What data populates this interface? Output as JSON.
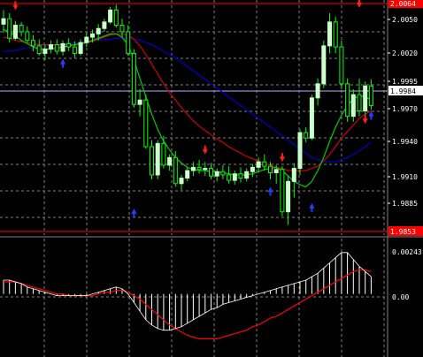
{
  "price_axis": {
    "labels": [
      "2.0050",
      "2.0020",
      "1.9995",
      "1.9970",
      "1.9940",
      "1.9910",
      "1.9885"
    ],
    "current_price": "1.9984",
    "high_line": "2.0064",
    "low_line": "1.9853"
  },
  "indicator_axis": {
    "labels": [
      "0.00243",
      "0.00"
    ]
  },
  "colors": {
    "background": "#000000",
    "grid": "#808080",
    "bull_candle": "#ccffcc",
    "wick": "#00ff00",
    "ma_fast": "#00cc00",
    "ma_mid": "#cc0000",
    "ma_slow": "#0000cc",
    "signal_line": "#ff0000",
    "hline": "#ff0000",
    "current_line": "#b0b0ff",
    "arrow_down": "#ff2020",
    "arrow_up": "#2040ff",
    "histogram": "#ffffff"
  },
  "chart_data": [
    {
      "type": "candlestick",
      "ylim": [
        1.9853,
        2.0064
      ],
      "grid": true,
      "candles": [
        [
          2.0045,
          2.0058,
          2.0037,
          2.005
        ],
        [
          2.005,
          2.0055,
          2.0028,
          2.0032
        ],
        [
          2.0032,
          2.0048,
          2.003,
          2.0044
        ],
        [
          2.0044,
          2.0047,
          2.0034,
          2.0038
        ],
        [
          2.0038,
          2.0043,
          2.0028,
          2.003
        ],
        [
          2.003,
          2.0035,
          2.002,
          2.0025
        ],
        [
          2.0025,
          2.0031,
          2.0016,
          2.0018
        ],
        [
          2.0018,
          2.0026,
          2.0012,
          2.0022
        ],
        [
          2.0022,
          2.003,
          2.0018,
          2.0026
        ],
        [
          2.0026,
          2.0031,
          2.0017,
          2.002
        ],
        [
          2.002,
          2.003,
          2.0016,
          2.0027
        ],
        [
          2.0027,
          2.0032,
          2.002,
          2.0024
        ],
        [
          2.0024,
          2.0029,
          2.0014,
          2.0018
        ],
        [
          2.0018,
          2.0031,
          2.0016,
          2.0028
        ],
        [
          2.0028,
          2.0037,
          2.0024,
          2.0033
        ],
        [
          2.0033,
          2.004,
          2.0028,
          2.0036
        ],
        [
          2.0036,
          2.0045,
          2.003,
          2.0041
        ],
        [
          2.0041,
          2.005,
          2.0038,
          2.0047
        ],
        [
          2.0047,
          2.0061,
          2.0045,
          2.0058
        ],
        [
          2.0058,
          2.0063,
          2.0042,
          2.0044
        ],
        [
          2.0044,
          2.005,
          2.0033,
          2.0038
        ],
        [
          2.0038,
          2.0044,
          2.0016,
          2.0018
        ],
        [
          2.0018,
          2.0022,
          1.9968,
          1.9971
        ],
        [
          1.9971,
          1.9985,
          1.996,
          1.9975
        ],
        [
          1.9975,
          1.998,
          1.993,
          1.9932
        ],
        [
          1.9932,
          1.9938,
          1.9902,
          1.9906
        ],
        [
          1.9906,
          1.9938,
          1.9902,
          1.9935
        ],
        [
          1.9935,
          1.9942,
          1.9912,
          1.9915
        ],
        [
          1.9915,
          1.9925,
          1.991,
          1.9922
        ],
        [
          1.9922,
          1.9928,
          1.9895,
          1.9898
        ],
        [
          1.9898,
          1.9906,
          1.9892,
          1.9903
        ],
        [
          1.9903,
          1.9913,
          1.99,
          1.991
        ],
        [
          1.991,
          1.9918,
          1.9905,
          1.9913
        ],
        [
          1.9913,
          1.992,
          1.9907,
          1.9911
        ],
        [
          1.9911,
          1.9918,
          1.9905,
          1.9912
        ],
        [
          1.9912,
          1.9917,
          1.9902,
          1.9905
        ],
        [
          1.9905,
          1.9912,
          1.99,
          1.9909
        ],
        [
          1.9909,
          1.9915,
          1.9902,
          1.9906
        ],
        [
          1.9906,
          1.9914,
          1.9898,
          1.9901
        ],
        [
          1.9901,
          1.991,
          1.9897,
          1.9907
        ],
        [
          1.9907,
          1.9913,
          1.9899,
          1.9903
        ],
        [
          1.9903,
          1.9912,
          1.99,
          1.9909
        ],
        [
          1.9909,
          1.9916,
          1.9904,
          1.9913
        ],
        [
          1.9913,
          1.9922,
          1.9908,
          1.9918
        ],
        [
          1.9918,
          1.9925,
          1.991,
          1.9914
        ],
        [
          1.9914,
          1.9918,
          1.9902,
          1.9908
        ],
        [
          1.9908,
          1.9915,
          1.9898,
          1.9911
        ],
        [
          1.9911,
          1.9914,
          1.9868,
          1.9872
        ],
        [
          1.9872,
          1.9905,
          1.986,
          1.99
        ],
        [
          1.99,
          1.9917,
          1.9885,
          1.9912
        ],
        [
          1.9912,
          1.9948,
          1.9906,
          1.9945
        ],
        [
          1.9945,
          1.995,
          1.9936,
          1.994
        ],
        [
          1.994,
          1.998,
          1.9938,
          1.9977
        ],
        [
          1.9977,
          1.9995,
          1.997,
          1.999
        ],
        [
          1.999,
          2.003,
          1.9986,
          2.0025
        ],
        [
          2.0025,
          2.0055,
          2.0018,
          2.0047
        ],
        [
          2.0047,
          2.0052,
          2.0018,
          2.0024
        ],
        [
          2.0024,
          2.003,
          1.9985,
          1.999
        ],
        [
          1.999,
          1.9995,
          1.9955,
          1.996
        ],
        [
          1.996,
          1.9985,
          1.9955,
          1.998
        ],
        [
          1.998,
          1.9995,
          1.996,
          1.9965
        ],
        [
          1.9965,
          1.9992,
          1.9958,
          1.9988
        ],
        [
          1.9988,
          1.9994,
          1.9966,
          1.997
        ]
      ],
      "ma_fast": [
        2.004,
        2.0038,
        2.0034,
        2.003,
        2.0027,
        2.0024,
        2.0022,
        2.0022,
        2.0022,
        2.0023,
        2.0024,
        2.0025,
        2.0026,
        2.0027,
        2.0028,
        2.003,
        2.0032,
        2.0034,
        2.0036,
        2.0036,
        2.0033,
        2.0026,
        2.0012,
        1.9995,
        1.9978,
        1.9962,
        1.9948,
        1.9937,
        1.9929,
        1.9922,
        1.9917,
        1.9913,
        1.9911,
        1.991,
        1.991,
        1.9909,
        1.9909,
        1.9908,
        1.9907,
        1.9906,
        1.9906,
        1.9906,
        1.9907,
        1.9909,
        1.9911,
        1.9912,
        1.9913,
        1.991,
        1.9905,
        1.99,
        1.9897,
        1.9895,
        1.99,
        1.991,
        1.9922,
        1.9937,
        1.995,
        1.9961,
        1.997,
        1.9976,
        1.9979,
        1.9978,
        1.9975
      ],
      "ma_mid": [
        2.0033,
        2.0032,
        2.003,
        2.0029,
        2.0028,
        2.0027,
        2.0026,
        2.0026,
        2.0026,
        2.0026,
        2.0026,
        2.0026,
        2.0026,
        2.0027,
        2.0028,
        2.0029,
        2.0031,
        2.0033,
        2.0035,
        2.0036,
        2.0036,
        2.0035,
        2.0031,
        2.0025,
        2.0017,
        2.0008,
        1.9999,
        1.999,
        1.9982,
        1.9975,
        1.9968,
        1.9962,
        1.9956,
        1.9951,
        1.9947,
        1.9943,
        1.9939,
        1.9936,
        1.9932,
        1.9929,
        1.9926,
        1.9923,
        1.9921,
        1.9919,
        1.9917,
        1.9915,
        1.9913,
        1.9912,
        1.991,
        1.991,
        1.991,
        1.991,
        1.9912,
        1.9914,
        1.9919,
        1.9925,
        1.9932,
        1.994,
        1.9946,
        1.9952,
        1.9958,
        1.9962,
        1.9965
      ],
      "ma_slow": [
        2.002,
        2.002,
        2.0021,
        2.0022,
        2.0023,
        2.0024,
        2.0025,
        2.0025,
        2.0026,
        2.0026,
        2.0027,
        2.0027,
        2.0028,
        2.0028,
        2.0029,
        2.003,
        2.003,
        2.0031,
        2.0031,
        2.0032,
        2.0032,
        2.0032,
        2.0031,
        2.003,
        2.0028,
        2.0026,
        2.0023,
        2.002,
        2.0017,
        2.0014,
        2.001,
        2.0006,
        2.0002,
        1.9998,
        1.9994,
        1.999,
        1.9986,
        1.9982,
        1.9978,
        1.9974,
        1.997,
        1.9966,
        1.9962,
        1.9958,
        1.9954,
        1.995,
        1.9946,
        1.9942,
        1.9938,
        1.9934,
        1.993,
        1.9926,
        1.9922,
        1.992,
        1.9918,
        1.9918,
        1.9918,
        1.992,
        1.9922,
        1.9925,
        1.9928,
        1.9932,
        1.9936
      ],
      "arrows_down": [
        [
          2,
          2.0058
        ],
        [
          18,
          2.0068
        ],
        [
          34,
          1.9925
        ],
        [
          47,
          1.9918
        ],
        [
          60,
          2.006
        ],
        [
          61,
          1.9953
        ]
      ],
      "arrows_up": [
        [
          10,
          2.0013
        ],
        [
          22,
          1.9875
        ],
        [
          45,
          1.9895
        ],
        [
          52,
          1.988
        ],
        [
          62,
          1.9965
        ]
      ]
    },
    {
      "type": "histogram+line",
      "ylim": [
        -0.0035,
        0.0029
      ],
      "histogram": [
        0.0008,
        0.0008,
        0.0007,
        0.0006,
        0.0004,
        0.0003,
        0.0002,
        0.0001,
        0.0,
        -0.0001,
        -0.0001,
        -0.0001,
        -0.0001,
        -0.0001,
        -0.0001,
        0.0,
        0.0001,
        0.0002,
        0.0003,
        0.0004,
        0.0003,
        0.0,
        -0.0005,
        -0.001,
        -0.0015,
        -0.0018,
        -0.002,
        -0.0021,
        -0.0021,
        -0.002,
        -0.0019,
        -0.0017,
        -0.0015,
        -0.0013,
        -0.0011,
        -0.0009,
        -0.0008,
        -0.0006,
        -0.0005,
        -0.0004,
        -0.0003,
        -0.0002,
        -0.0001,
        0.0,
        0.0001,
        0.0002,
        0.0003,
        0.0004,
        0.0005,
        0.0006,
        0.0007,
        0.0008,
        0.001,
        0.0012,
        0.0015,
        0.0018,
        0.0021,
        0.0024,
        0.0024,
        0.002,
        0.0016,
        0.0013,
        0.001
      ],
      "signal_line": [
        0.0007,
        0.0007,
        0.0007,
        0.0006,
        0.0005,
        0.0004,
        0.0003,
        0.0002,
        0.0001,
        0.0,
        0.0,
        -0.0001,
        -0.0001,
        -0.0001,
        -0.0001,
        -0.0001,
        0.0,
        0.0001,
        0.0001,
        0.0002,
        0.0002,
        0.0001,
        -0.0001,
        -0.0003,
        -0.0006,
        -0.0009,
        -0.0012,
        -0.0015,
        -0.0018,
        -0.002,
        -0.0022,
        -0.0024,
        -0.0025,
        -0.0026,
        -0.0026,
        -0.0026,
        -0.0026,
        -0.0025,
        -0.0024,
        -0.0023,
        -0.0022,
        -0.0021,
        -0.0019,
        -0.0018,
        -0.0016,
        -0.0014,
        -0.0013,
        -0.0011,
        -0.0009,
        -0.0007,
        -0.0005,
        -0.0003,
        -0.0001,
        0.0001,
        0.0003,
        0.0005,
        0.0007,
        0.0009,
        0.0011,
        0.0013,
        0.0014,
        0.0014,
        0.0013
      ]
    }
  ]
}
